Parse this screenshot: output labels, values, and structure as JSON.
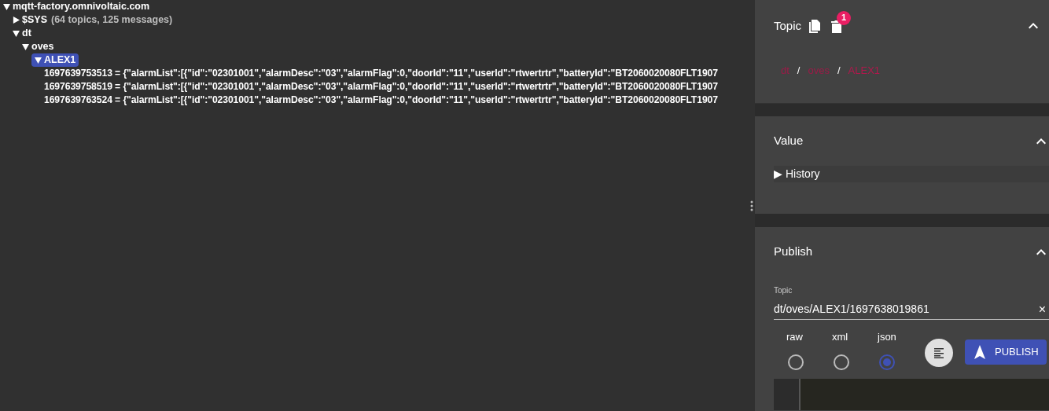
{
  "tree": {
    "label": "mqtt-factory.omnivoltaic.com",
    "expanded": true,
    "selected": false,
    "children": [
      {
        "label": "$SYS",
        "summary": "(64 topics, 125 messages)",
        "expanded": false,
        "selected": false
      },
      {
        "label": "dt",
        "expanded": true,
        "selected": false,
        "children": [
          {
            "label": "oves",
            "expanded": true,
            "selected": false,
            "children": [
              {
                "label": "ALEX1",
                "expanded": true,
                "selected": true,
                "children": [
                  {
                    "label": "1697639753513 = {\"alarmList\":[{\"id\":\"02301001\",\"alarmDesc\":\"03\",\"alarmFlag\":0,\"doorId\":\"11\",\"userId\":\"rtwertrtr\",\"batteryId\":\"BT2060020080FLT1907"
                  },
                  {
                    "label": "1697639758519 = {\"alarmList\":[{\"id\":\"02301001\",\"alarmDesc\":\"03\",\"alarmFlag\":0,\"doorId\":\"11\",\"userId\":\"rtwertrtr\",\"batteryId\":\"BT2060020080FLT1907"
                  },
                  {
                    "label": "1697639763524 = {\"alarmList\":[{\"id\":\"02301001\",\"alarmDesc\":\"03\",\"alarmFlag\":0,\"doorId\":\"11\",\"userId\":\"rtwertrtr\",\"batteryId\":\"BT2060020080FLT1907"
                  }
                ]
              }
            ]
          }
        ]
      }
    ]
  },
  "topic_panel": {
    "title": "Topic",
    "badge": "1",
    "expanded": true,
    "breadcrumb": [
      "dt",
      "oves",
      "ALEX1"
    ],
    "separator": "/"
  },
  "value_panel": {
    "title": "Value",
    "expanded": true,
    "history": {
      "label": "History",
      "expanded": false,
      "arrow": "▶"
    }
  },
  "publish_panel": {
    "title": "Publish",
    "expanded": true,
    "topic_label": "Topic",
    "topic_value": "dt/oves/ALEX1/1697638019861",
    "clear": "×",
    "formats": [
      {
        "label": "raw",
        "selected": false
      },
      {
        "label": "xml",
        "selected": false
      },
      {
        "label": "json",
        "selected": true
      }
    ],
    "publish_button": "PUBLISH"
  }
}
